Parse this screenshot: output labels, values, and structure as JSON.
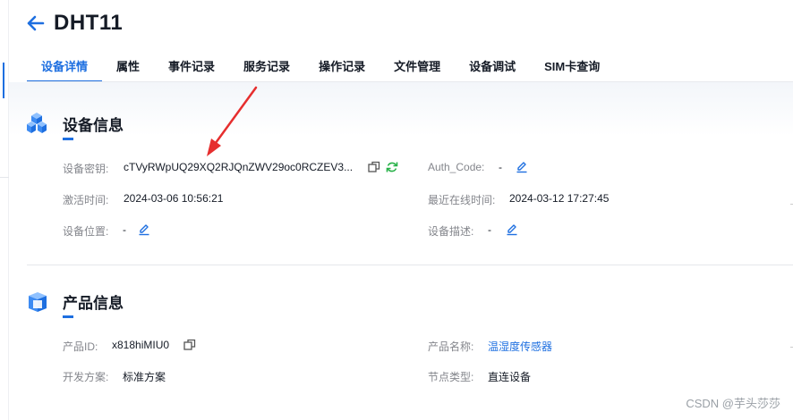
{
  "page": {
    "title": "DHT11"
  },
  "tabs": [
    "设备详情",
    "属性",
    "事件记录",
    "服务记录",
    "操作记录",
    "文件管理",
    "设备调试",
    "SIM卡查询"
  ],
  "device_info": {
    "heading": "设备信息",
    "secret_label": "设备密钥:",
    "secret_value": "cTVyRWpUQ29XQ2RJQnZWV29oc0RCZEV3...",
    "auth_label": "Auth_Code:",
    "auth_value": "-",
    "activated_label": "激活时间:",
    "activated_value": "2024-03-06 10:56:21",
    "last_online_label": "最近在线时间:",
    "last_online_value": "2024-03-12 17:27:45",
    "location_label": "设备位置:",
    "location_value": "-",
    "desc_label": "设备描述:",
    "desc_value": "-"
  },
  "product_info": {
    "heading": "产品信息",
    "id_label": "产品ID:",
    "id_value": "x818hiMIU0",
    "name_label": "产品名称:",
    "name_value": "温湿度传感器",
    "dev_plan_label": "开发方案:",
    "dev_plan_value": "标准方案",
    "node_type_label": "节点类型:",
    "node_type_value": "直连设备"
  },
  "watermark": "CSDN @芋头莎莎",
  "colors": {
    "accent": "#1e6fe0",
    "refresh": "#27b148",
    "annotation_arrow": "#e62e2e"
  },
  "icons": {
    "back": "arrow-left-icon",
    "copy": "copy-icon",
    "refresh": "refresh-icon",
    "edit": "edit-pencil-icon"
  }
}
